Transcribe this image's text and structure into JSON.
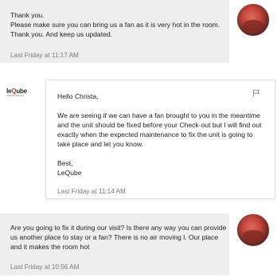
{
  "messages": [
    {
      "id": "msg1",
      "from": "guest",
      "text": "Thank you.\nPlease make sure you can bring us a fan as it is very hot in the room.\nThank you. And keep us updated.",
      "timestamp": "Last Friday at 11:17 AM"
    },
    {
      "id": "msg2",
      "from": "host",
      "greeting": "Hello Christa,",
      "body": "We are seeing if we can have a fan brought to you in the meantime and the unit should be fixed before your Check-out but I will find out exactly when the expected maintenance to fix the unit is going to take place and let you know.",
      "signoff": "Best,\nLeQube",
      "timestamp": "Last Friday at 11:14 AM"
    },
    {
      "id": "msg3",
      "from": "guest",
      "text": "Are you going to fix it during our visit? Is there any way you can provide us another place to stay or a fan? There is no air moving l. Our place and it makes the room hot",
      "timestamp": "Last Friday at 10:56 AM"
    }
  ],
  "host_logo": {
    "brand_prefix": "le",
    "brand_q": "Q",
    "brand_suffix": "ube",
    "tagline": "APPARTMENTS"
  },
  "icons": {
    "flag": "flag-icon",
    "avatar": "guest-avatar"
  },
  "colors": {
    "guest_bubble": "#eeeeee",
    "host_bubble": "#ffffff",
    "timestamp": "#777777",
    "logo_accent": "#c0392b"
  }
}
